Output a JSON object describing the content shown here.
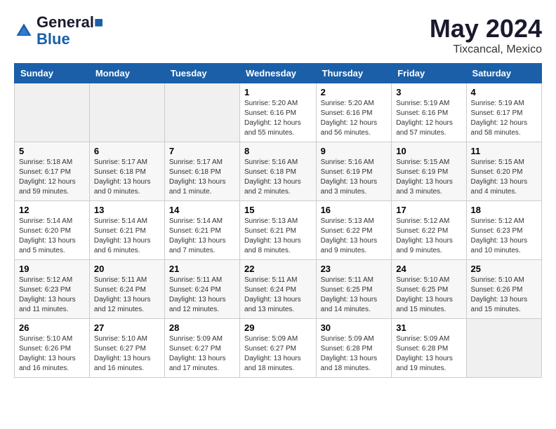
{
  "header": {
    "logo_line1": "General",
    "logo_line2": "Blue",
    "month": "May 2024",
    "location": "Tixcancal, Mexico"
  },
  "weekdays": [
    "Sunday",
    "Monday",
    "Tuesday",
    "Wednesday",
    "Thursday",
    "Friday",
    "Saturday"
  ],
  "weeks": [
    [
      {
        "day": "",
        "info": ""
      },
      {
        "day": "",
        "info": ""
      },
      {
        "day": "",
        "info": ""
      },
      {
        "day": "1",
        "info": "Sunrise: 5:20 AM\nSunset: 6:16 PM\nDaylight: 12 hours\nand 55 minutes."
      },
      {
        "day": "2",
        "info": "Sunrise: 5:20 AM\nSunset: 6:16 PM\nDaylight: 12 hours\nand 56 minutes."
      },
      {
        "day": "3",
        "info": "Sunrise: 5:19 AM\nSunset: 6:16 PM\nDaylight: 12 hours\nand 57 minutes."
      },
      {
        "day": "4",
        "info": "Sunrise: 5:19 AM\nSunset: 6:17 PM\nDaylight: 12 hours\nand 58 minutes."
      }
    ],
    [
      {
        "day": "5",
        "info": "Sunrise: 5:18 AM\nSunset: 6:17 PM\nDaylight: 12 hours\nand 59 minutes."
      },
      {
        "day": "6",
        "info": "Sunrise: 5:17 AM\nSunset: 6:18 PM\nDaylight: 13 hours\nand 0 minutes."
      },
      {
        "day": "7",
        "info": "Sunrise: 5:17 AM\nSunset: 6:18 PM\nDaylight: 13 hours\nand 1 minute."
      },
      {
        "day": "8",
        "info": "Sunrise: 5:16 AM\nSunset: 6:18 PM\nDaylight: 13 hours\nand 2 minutes."
      },
      {
        "day": "9",
        "info": "Sunrise: 5:16 AM\nSunset: 6:19 PM\nDaylight: 13 hours\nand 3 minutes."
      },
      {
        "day": "10",
        "info": "Sunrise: 5:15 AM\nSunset: 6:19 PM\nDaylight: 13 hours\nand 3 minutes."
      },
      {
        "day": "11",
        "info": "Sunrise: 5:15 AM\nSunset: 6:20 PM\nDaylight: 13 hours\nand 4 minutes."
      }
    ],
    [
      {
        "day": "12",
        "info": "Sunrise: 5:14 AM\nSunset: 6:20 PM\nDaylight: 13 hours\nand 5 minutes."
      },
      {
        "day": "13",
        "info": "Sunrise: 5:14 AM\nSunset: 6:21 PM\nDaylight: 13 hours\nand 6 minutes."
      },
      {
        "day": "14",
        "info": "Sunrise: 5:14 AM\nSunset: 6:21 PM\nDaylight: 13 hours\nand 7 minutes."
      },
      {
        "day": "15",
        "info": "Sunrise: 5:13 AM\nSunset: 6:21 PM\nDaylight: 13 hours\nand 8 minutes."
      },
      {
        "day": "16",
        "info": "Sunrise: 5:13 AM\nSunset: 6:22 PM\nDaylight: 13 hours\nand 9 minutes."
      },
      {
        "day": "17",
        "info": "Sunrise: 5:12 AM\nSunset: 6:22 PM\nDaylight: 13 hours\nand 9 minutes."
      },
      {
        "day": "18",
        "info": "Sunrise: 5:12 AM\nSunset: 6:23 PM\nDaylight: 13 hours\nand 10 minutes."
      }
    ],
    [
      {
        "day": "19",
        "info": "Sunrise: 5:12 AM\nSunset: 6:23 PM\nDaylight: 13 hours\nand 11 minutes."
      },
      {
        "day": "20",
        "info": "Sunrise: 5:11 AM\nSunset: 6:24 PM\nDaylight: 13 hours\nand 12 minutes."
      },
      {
        "day": "21",
        "info": "Sunrise: 5:11 AM\nSunset: 6:24 PM\nDaylight: 13 hours\nand 12 minutes."
      },
      {
        "day": "22",
        "info": "Sunrise: 5:11 AM\nSunset: 6:24 PM\nDaylight: 13 hours\nand 13 minutes."
      },
      {
        "day": "23",
        "info": "Sunrise: 5:11 AM\nSunset: 6:25 PM\nDaylight: 13 hours\nand 14 minutes."
      },
      {
        "day": "24",
        "info": "Sunrise: 5:10 AM\nSunset: 6:25 PM\nDaylight: 13 hours\nand 15 minutes."
      },
      {
        "day": "25",
        "info": "Sunrise: 5:10 AM\nSunset: 6:26 PM\nDaylight: 13 hours\nand 15 minutes."
      }
    ],
    [
      {
        "day": "26",
        "info": "Sunrise: 5:10 AM\nSunset: 6:26 PM\nDaylight: 13 hours\nand 16 minutes."
      },
      {
        "day": "27",
        "info": "Sunrise: 5:10 AM\nSunset: 6:27 PM\nDaylight: 13 hours\nand 16 minutes."
      },
      {
        "day": "28",
        "info": "Sunrise: 5:09 AM\nSunset: 6:27 PM\nDaylight: 13 hours\nand 17 minutes."
      },
      {
        "day": "29",
        "info": "Sunrise: 5:09 AM\nSunset: 6:27 PM\nDaylight: 13 hours\nand 18 minutes."
      },
      {
        "day": "30",
        "info": "Sunrise: 5:09 AM\nSunset: 6:28 PM\nDaylight: 13 hours\nand 18 minutes."
      },
      {
        "day": "31",
        "info": "Sunrise: 5:09 AM\nSunset: 6:28 PM\nDaylight: 13 hours\nand 19 minutes."
      },
      {
        "day": "",
        "info": ""
      }
    ]
  ]
}
